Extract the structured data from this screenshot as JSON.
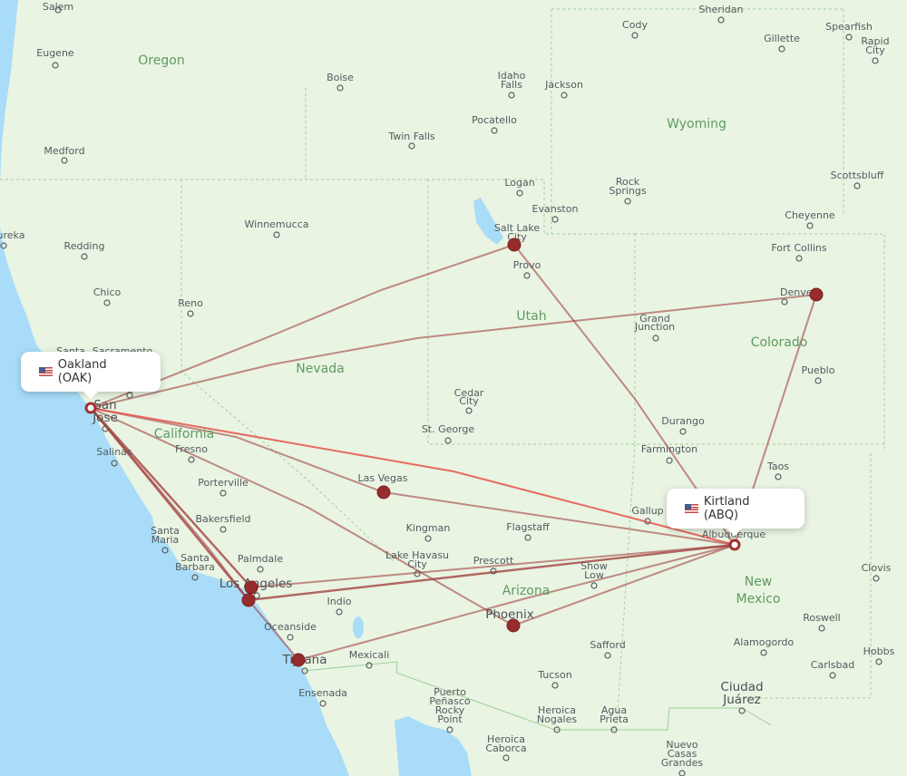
{
  "map": {
    "colors": {
      "land": "#e9f4e3",
      "water": "#a8dcf8",
      "route": "#a3413f",
      "route_highlight": "#e8524a",
      "airport_marker": "#962c2c",
      "state_label": "#5f9a5f",
      "city_label": "#555a5e",
      "border": "#9fd09a"
    },
    "origin": {
      "name": "Oakland",
      "code": "OAK",
      "label": "Oakland (OAK)",
      "flag": "us-flag-icon"
    },
    "destination": {
      "name": "Kirtland",
      "code": "ABQ",
      "label": "Kirtland (ABQ)",
      "flag": "us-flag-icon"
    },
    "state_labels": [
      "Oregon",
      "Wyoming",
      "Utah",
      "Nevada",
      "California",
      "Colorado",
      "Arizona",
      "New",
      "Mexico"
    ],
    "cities": [
      {
        "name": "Salem"
      },
      {
        "name": "Eugene"
      },
      {
        "name": "Medford"
      },
      {
        "name": "ureka"
      },
      {
        "name": "Redding"
      },
      {
        "name": "Chico"
      },
      {
        "name": "Reno"
      },
      {
        "name": "Santa"
      },
      {
        "name": "Sacramento"
      },
      {
        "name": "Boise"
      },
      {
        "name": "Idaho"
      },
      {
        "name": "Falls"
      },
      {
        "name": "Jackson"
      },
      {
        "name": "Pocatello"
      },
      {
        "name": "Twin Falls"
      },
      {
        "name": "Cody"
      },
      {
        "name": "Sheridan"
      },
      {
        "name": "Gillette"
      },
      {
        "name": "Spearfish"
      },
      {
        "name": "Rapid"
      },
      {
        "name": "City"
      },
      {
        "name": "Scottsbluff"
      },
      {
        "name": "Cheyenne"
      },
      {
        "name": "Fort Collins"
      },
      {
        "name": "Denver"
      },
      {
        "name": "Logan"
      },
      {
        "name": "Evanston"
      },
      {
        "name": "Rock"
      },
      {
        "name": "Springs"
      },
      {
        "name": "Salt Lake"
      },
      {
        "name": "City"
      },
      {
        "name": "Provo"
      },
      {
        "name": "Winnemucca"
      },
      {
        "name": "Grand"
      },
      {
        "name": "Junction"
      },
      {
        "name": "Pueblo"
      },
      {
        "name": "Cedar"
      },
      {
        "name": "City"
      },
      {
        "name": "St. George"
      },
      {
        "name": "Durango"
      },
      {
        "name": "Farmington"
      },
      {
        "name": "Taos"
      },
      {
        "name": "San"
      },
      {
        "name": "Jose"
      },
      {
        "name": "Salinas"
      },
      {
        "name": "Fresno"
      },
      {
        "name": "Porterville"
      },
      {
        "name": "Bakersfield"
      },
      {
        "name": "Santa"
      },
      {
        "name": "Maria"
      },
      {
        "name": "Santa"
      },
      {
        "name": "Barbara"
      },
      {
        "name": "Palmdale"
      },
      {
        "name": "Los Angeles"
      },
      {
        "name": "Las Vegas"
      },
      {
        "name": "Kingman"
      },
      {
        "name": "Flagstaff"
      },
      {
        "name": "Lake Havasu"
      },
      {
        "name": "City"
      },
      {
        "name": "Prescott"
      },
      {
        "name": "Show"
      },
      {
        "name": "Low"
      },
      {
        "name": "Gallup"
      },
      {
        "name": "Albuquerque"
      },
      {
        "name": "Indio"
      },
      {
        "name": "Oceanside"
      },
      {
        "name": "Phoenix"
      },
      {
        "name": "Tijuana"
      },
      {
        "name": "Mexicali"
      },
      {
        "name": "Ensenada"
      },
      {
        "name": "Safford"
      },
      {
        "name": "Tucson"
      },
      {
        "name": "Puerto"
      },
      {
        "name": "Peñasco"
      },
      {
        "name": "Rocky"
      },
      {
        "name": "Point"
      },
      {
        "name": "Heroica"
      },
      {
        "name": "Nogales"
      },
      {
        "name": "Agua"
      },
      {
        "name": "Prieta"
      },
      {
        "name": "Heroica"
      },
      {
        "name": "Caborca"
      },
      {
        "name": "Alamogordo"
      },
      {
        "name": "Roswell"
      },
      {
        "name": "Clovis"
      },
      {
        "name": "Hobbs"
      },
      {
        "name": "Carlsbad"
      },
      {
        "name": "Ciudad"
      },
      {
        "name": "Juárez"
      },
      {
        "name": "Nuevo"
      },
      {
        "name": "Casas"
      },
      {
        "name": "Grandes"
      }
    ],
    "airports": [
      "Oakland",
      "Kirtland",
      "Salt Lake City",
      "Denver",
      "Las Vegas",
      "Los Angeles (north)",
      "Los Angeles (south)",
      "Tijuana",
      "Phoenix"
    ],
    "routes": [
      {
        "from": "Oakland",
        "to": "Kirtland",
        "type": "direct"
      },
      {
        "from": "Oakland",
        "to": "Salt Lake City"
      },
      {
        "from": "Oakland",
        "to": "Denver"
      },
      {
        "from": "Oakland",
        "to": "Las Vegas"
      },
      {
        "from": "Oakland",
        "to": "Phoenix"
      },
      {
        "from": "Oakland",
        "to": "Los Angeles (north)"
      },
      {
        "from": "Oakland",
        "to": "Los Angeles (south)"
      },
      {
        "from": "Oakland",
        "to": "Tijuana"
      },
      {
        "from": "Salt Lake City",
        "to": "Kirtland"
      },
      {
        "from": "Denver",
        "to": "Kirtland"
      },
      {
        "from": "Las Vegas",
        "to": "Kirtland"
      },
      {
        "from": "Los Angeles (north)",
        "to": "Kirtland"
      },
      {
        "from": "Los Angeles (south)",
        "to": "Kirtland"
      },
      {
        "from": "Tijuana",
        "to": "Kirtland"
      },
      {
        "from": "Phoenix",
        "to": "Kirtland"
      }
    ]
  }
}
